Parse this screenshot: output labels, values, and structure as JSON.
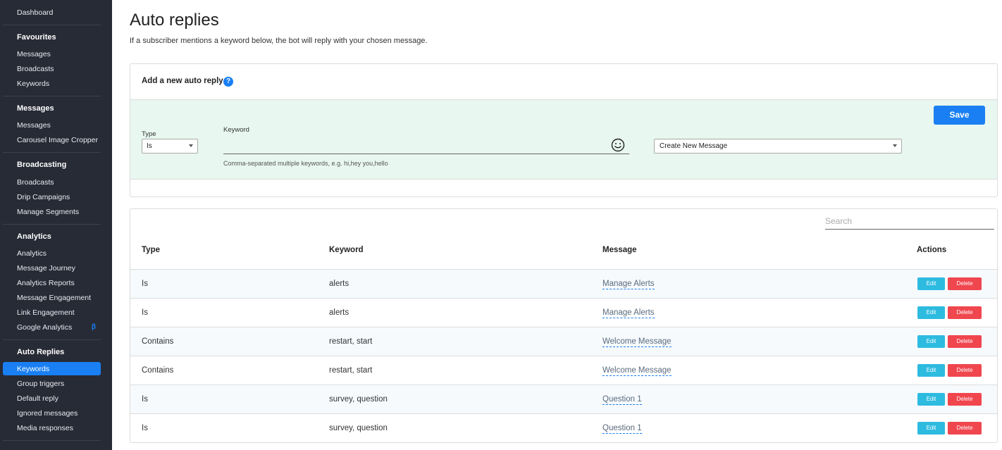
{
  "sidebar": {
    "top_link": "Dashboard",
    "sections": [
      {
        "title": "Favourites",
        "items": [
          "Messages",
          "Broadcasts",
          "Keywords"
        ]
      },
      {
        "title": "Messages",
        "items": [
          "Messages",
          "Carousel Image Cropper"
        ]
      },
      {
        "title": "Broadcasting",
        "items": [
          "Broadcasts",
          "Drip Campaigns",
          "Manage Segments"
        ]
      },
      {
        "title": "Analytics",
        "items": [
          "Analytics",
          "Message Journey",
          "Analytics Reports",
          "Message Engagement",
          "Link Engagement",
          "Google Analytics"
        ]
      },
      {
        "title": "Auto Replies",
        "items": [
          "Keywords",
          "Group triggers",
          "Default reply",
          "Ignored messages",
          "Media responses"
        ]
      }
    ],
    "beta_badge": "β",
    "active_item": "Keywords"
  },
  "header": {
    "title": "Auto replies",
    "subtitle": "If a subscriber mentions a keyword below, the bot will reply with your chosen message."
  },
  "add_form": {
    "heading": "Add a new auto reply",
    "help_icon": "?",
    "type_label": "Type",
    "type_value": "Is",
    "keyword_label": "Keyword",
    "keyword_value": "",
    "keyword_help": "Comma-separated multiple keywords, e.g. hi,hey you,hello",
    "message_value": "Create New Message",
    "save_label": "Save",
    "emoji_icon": "smiley-icon"
  },
  "table": {
    "search_placeholder": "Search",
    "columns": [
      "Type",
      "Keyword",
      "Message",
      "Actions"
    ],
    "edit_label": "Edit",
    "delete_label": "Delete",
    "rows": [
      {
        "type": "Is",
        "keyword": "alerts",
        "message": "Manage Alerts"
      },
      {
        "type": "Is",
        "keyword": "alerts",
        "message": "Manage Alerts"
      },
      {
        "type": "Contains",
        "keyword": "restart, start",
        "message": "Welcome Message"
      },
      {
        "type": "Contains",
        "keyword": "restart, start",
        "message": "Welcome Message"
      },
      {
        "type": "Is",
        "keyword": "survey, question",
        "message": "Question 1"
      },
      {
        "type": "Is",
        "keyword": "survey, question",
        "message": "Question 1"
      }
    ]
  },
  "colors": {
    "sidebar_bg": "#272b36",
    "accent": "#1a7ff3",
    "form_bg": "#e8f7ef",
    "edit": "#2dbbe0",
    "delete": "#f0464e"
  }
}
